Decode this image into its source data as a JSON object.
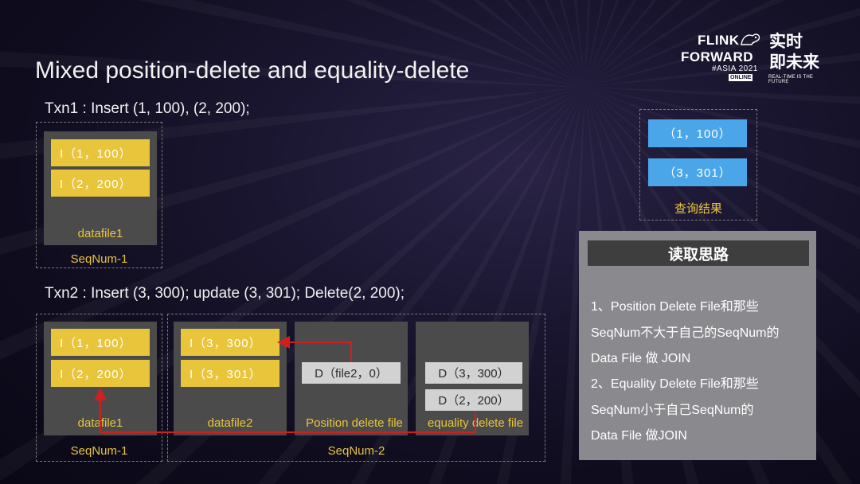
{
  "slide": {
    "title": "Mixed position-delete and equality-delete"
  },
  "logo": {
    "line1": "FLINK",
    "line2": "FORWARD",
    "line3": "#ASIA 2021",
    "badge": "ONLINE",
    "cn_line1": "实时",
    "cn_line2": "即未来",
    "tagline": "REAL-TIME IS THE FUTURE"
  },
  "txn1": {
    "text": "Txn1 : Insert (1, 100), (2, 200);",
    "datafile": {
      "rows": [
        "I（1，100）",
        "I（2，200）"
      ],
      "label": "datafile1"
    },
    "seq": "SeqNum-1"
  },
  "result": {
    "rows": [
      "（1，100）",
      "（3，301）"
    ],
    "label": "查询结果"
  },
  "txn2": {
    "text": "Txn2 : Insert (3, 300); update (3, 301); Delete(2, 200);",
    "datafile1": {
      "rows": [
        "I（1，100）",
        "I（2，200）"
      ],
      "label": "datafile1",
      "seq": "SeqNum-1"
    },
    "datafile2": {
      "rows": [
        "I（3，300）",
        "I（3，301）"
      ],
      "label": "datafile2"
    },
    "position_delete": {
      "rows": [
        "D（file2，0）"
      ],
      "label": "Position delete file"
    },
    "equality_delete": {
      "rows": [
        "D（3，300）",
        "D（2，200）"
      ],
      "label": "equality delete file"
    },
    "seq2": "SeqNum-2"
  },
  "reading": {
    "heading": "读取思路",
    "lines": [
      "1、Position Delete File和那些",
      "SeqNum不大于自己的SeqNum的",
      "Data File 做 JOIN",
      "2、Equality Delete File和那些",
      "SeqNum小于自己SeqNum的",
      "Data File 做JOIN"
    ]
  },
  "colors": {
    "yellow_row": "#e9c53c",
    "gray_row": "#d2d2d2",
    "blue_row": "#4aa6e8",
    "arrow": "#d11f1f",
    "panel": "#4b4b4b",
    "reading_box": "#8a8a8e"
  }
}
